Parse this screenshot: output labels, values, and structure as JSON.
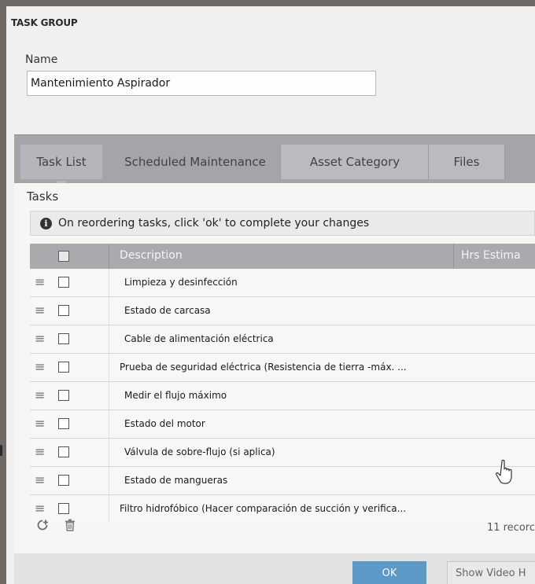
{
  "dialog": {
    "title": "TASK GROUP"
  },
  "name_field": {
    "label": "Name",
    "value": "Mantenimiento Aspirador"
  },
  "tabs": [
    {
      "label": "Task List",
      "active": true
    },
    {
      "label": "Scheduled Maintenance",
      "active": false
    },
    {
      "label": "Asset Category",
      "active": false
    },
    {
      "label": "Files",
      "active": false
    }
  ],
  "tasks": {
    "label": "Tasks",
    "notice": "On reordering tasks, click 'ok' to complete your changes",
    "columns": {
      "description": "Description",
      "hrs": "Hrs Estima"
    },
    "rows": [
      "Limpieza y desinfección",
      "Estado de carcasa",
      "Cable de alimentación eléctrica",
      "Prueba de seguridad eléctrica (Resistencia de tierra -máx. ...",
      "Medir el flujo máximo",
      "Estado del motor",
      "Válvula de sobre-flujo (si aplica)",
      "Estado de mangueras",
      "Filtro hidrofóbico (Hacer comparación de succión y verifica..."
    ],
    "records": "11 recorc"
  },
  "footer": {
    "ok_label": "OK",
    "video_label": "Show Video H"
  },
  "colors": {
    "accent": "#5b99c6",
    "tab_bar": "#a3a5a9",
    "header": "#a8aaae"
  }
}
